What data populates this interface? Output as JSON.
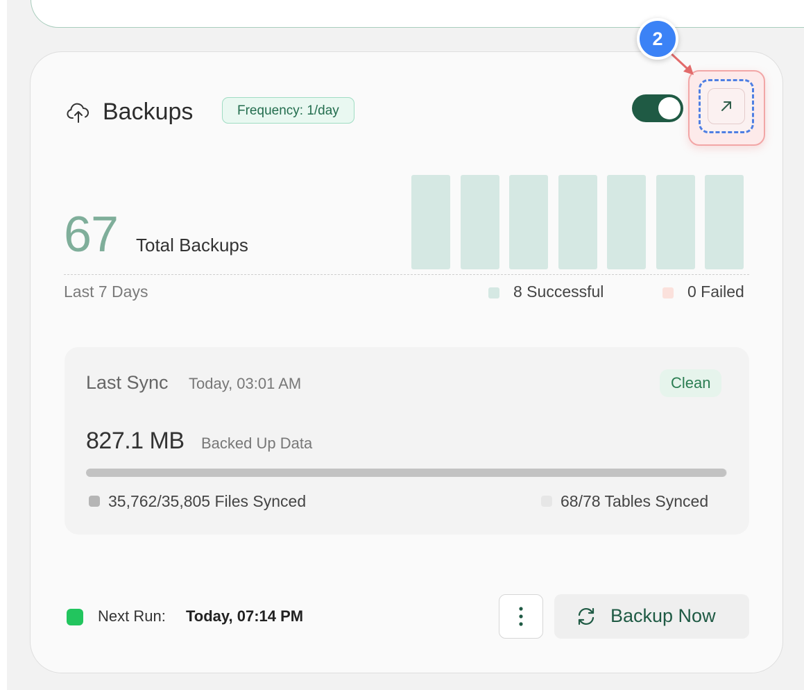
{
  "card": {
    "title": "Backups",
    "frequency_badge": "Frequency: 1/day",
    "toggle_on": true,
    "step_marker": "2"
  },
  "summary": {
    "total_value": "67",
    "total_label": "Total Backups",
    "period_label": "Last 7 Days",
    "legend": {
      "successful_label": "8 Successful",
      "failed_label": "0 Failed",
      "successful_color": "#d5e8e3",
      "failed_color": "#fbe1dc"
    }
  },
  "chart_data": {
    "type": "bar",
    "categories": [
      "",
      "",
      "",
      "",
      "",
      "",
      ""
    ],
    "series": [
      {
        "values": [
          1,
          1,
          1,
          1,
          1,
          1,
          1
        ]
      }
    ]
  },
  "sync": {
    "title": "Last Sync",
    "time": "Today, 03:01 AM",
    "status": "Clean",
    "size_value": "827.1 MB",
    "size_label": "Backed Up Data",
    "files_label": "35,762/35,805 Files Synced",
    "tables_label": "68/78 Tables Synced",
    "files_progress": 0.999
  },
  "footer": {
    "next_label": "Next Run:",
    "next_value": "Today, 07:14 PM",
    "status_color": "#22c55e",
    "backup_button_label": "Backup Now"
  },
  "icons": [
    "cloud-upload-icon",
    "expand-arrow-icon",
    "more-vertical-icon",
    "refresh-icon"
  ]
}
